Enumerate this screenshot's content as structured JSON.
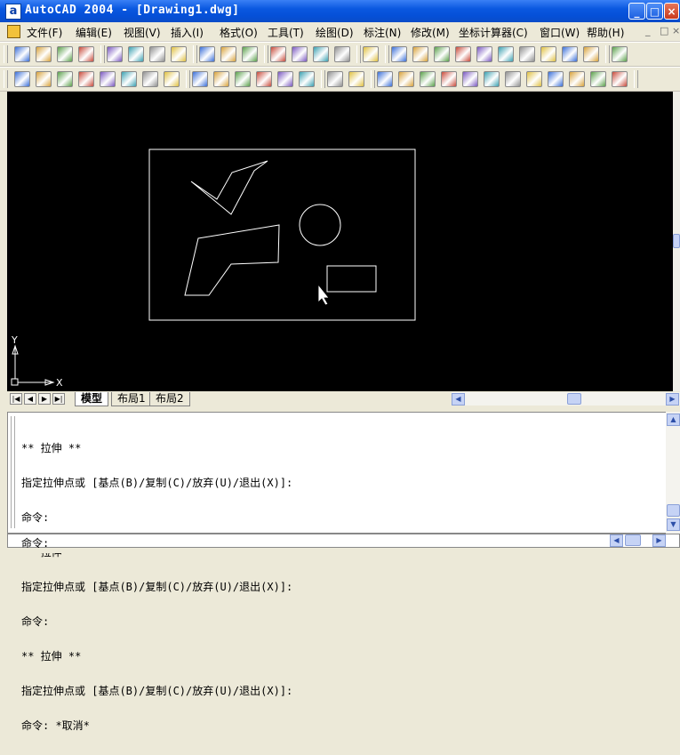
{
  "window": {
    "app_icon": "a",
    "title": "AutoCAD 2004 - [Drawing1.dwg]",
    "buttons": [
      "_",
      "□",
      "×"
    ]
  },
  "menu": {
    "items": [
      "文件(F)",
      "编辑(E)",
      "视图(V)",
      "插入(I)",
      "格式(O)",
      "工具(T)",
      "绘图(D)",
      "标注(N)",
      "修改(M)",
      "坐标计算器(C)",
      "窗口(W)",
      "帮助(H)"
    ],
    "mdi_buttons": [
      "_",
      "□",
      "×"
    ]
  },
  "icons": {
    "toolbar1": [
      "new-icon",
      "open-icon",
      "save-icon",
      "print-icon",
      "plot-preview-icon",
      "publish-icon",
      "cut-icon",
      "copy-icon",
      "paste-icon",
      "match-properties-icon",
      "undo-icon",
      "redo-icon",
      "pan-icon",
      "zoom-realtime-icon",
      "zoom-window-icon",
      "zoom-previous-icon",
      "properties-icon",
      "design-center-icon",
      "tool-palettes-icon",
      "help-icon",
      "snap-endpoint-icon",
      "snap-midpoint-icon",
      "snap-intersection-icon",
      "snap-apparent-icon",
      "snap-extension-icon",
      "snap-center-icon",
      "text-icon"
    ],
    "toolbar2": [
      "layer-icon",
      "group-icon",
      "ungroup-icon",
      "block-icon",
      "attribute-icon",
      "xref-icon",
      "image-icon",
      "ole-icon",
      "render-icon",
      "shade-icon",
      "light-icon",
      "material-icon",
      "scene-icon",
      "background-icon",
      "download-icon",
      "sum-icon",
      "dim-linear-icon",
      "dim-aligned-icon",
      "dim-ordinate-icon",
      "dim-radius-icon",
      "dim-diameter-icon",
      "dim-angular-icon",
      "dim-baseline-icon",
      "dim-continue-icon",
      "dim-quick-icon",
      "leader-icon",
      "tolerance-icon",
      "center-mark-icon"
    ]
  },
  "canvas": {
    "background": "#000000",
    "ucs": {
      "y_label": "Y",
      "x_label": "X"
    }
  },
  "layout_tabs": {
    "nav": [
      "|◀",
      "◀",
      "▶",
      "▶|"
    ],
    "tabs": [
      "模型",
      "布局1",
      "布局2"
    ],
    "active": "模型"
  },
  "command": {
    "lines": [
      "** 拉伸 **",
      "指定拉伸点或 [基点(B)/复制(C)/放弃(U)/退出(X)]:",
      "命令:",
      "** 拉伸 **",
      "指定拉伸点或 [基点(B)/复制(C)/放弃(U)/退出(X)]:",
      "命令:",
      "** 拉伸 **",
      "指定拉伸点或 [基点(B)/复制(C)/放弃(U)/退出(X)]:",
      "命令: *取消*"
    ],
    "prompt": "命令:"
  }
}
